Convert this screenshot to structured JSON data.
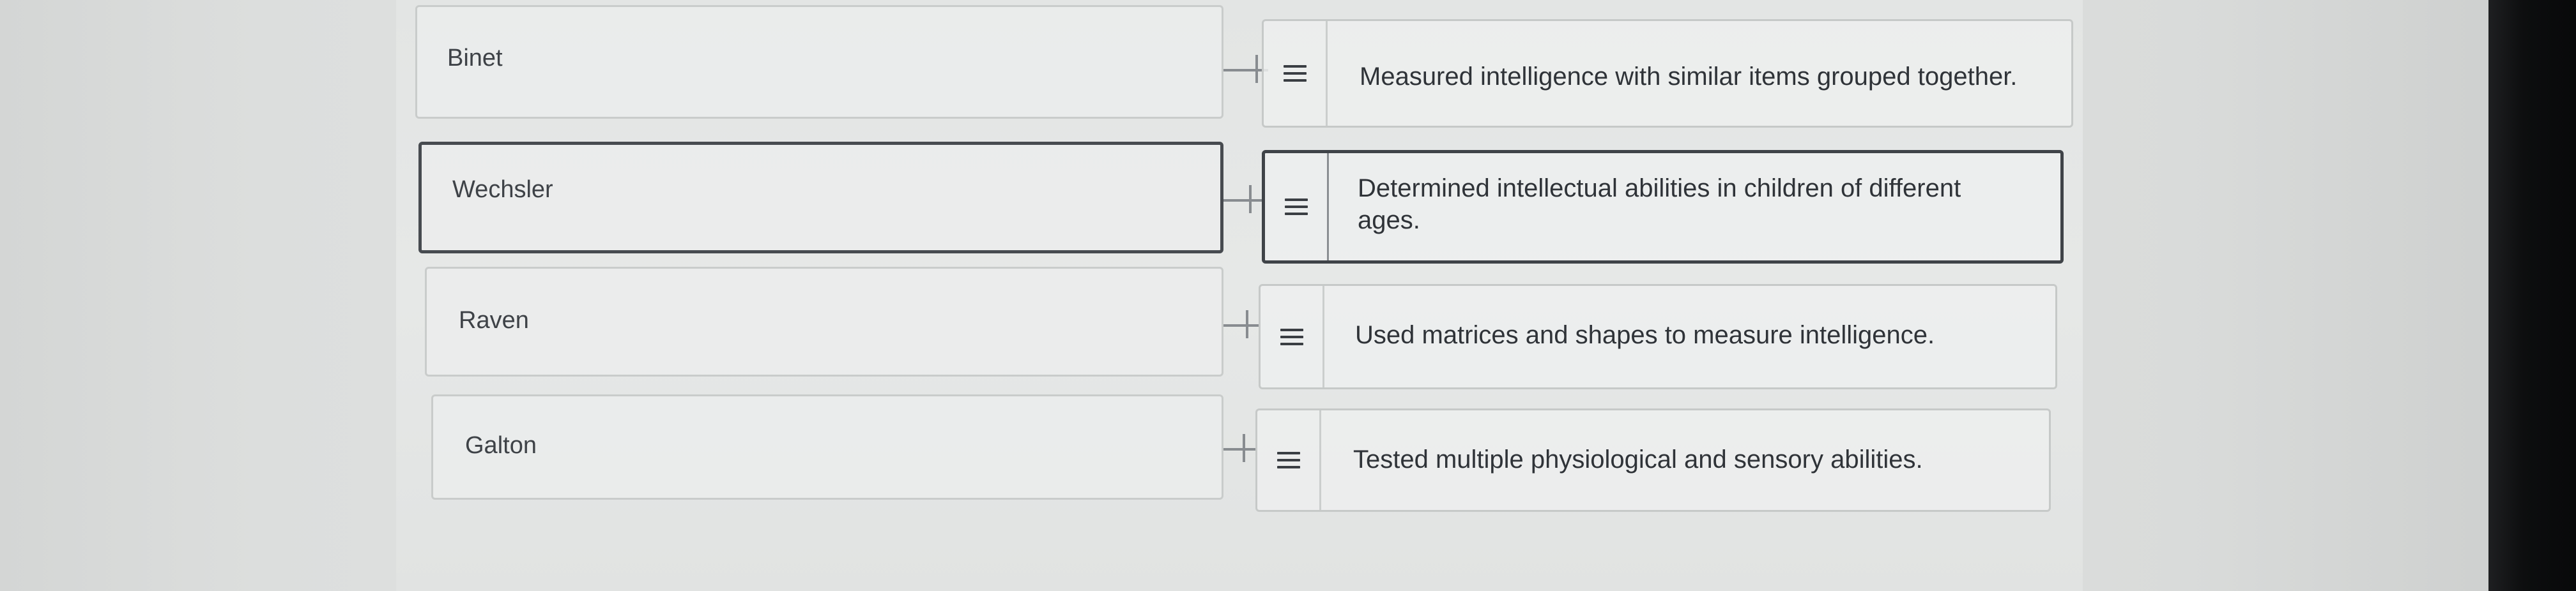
{
  "matching": {
    "rows": [
      {
        "term": "Binet",
        "definition": "Measured intelligence with similar items grouped together."
      },
      {
        "term": "Wechsler",
        "definition": "Determined intellectual abilities in children of different ages."
      },
      {
        "term": "Raven",
        "definition": "Used matrices and shapes to measure intelligence."
      },
      {
        "term": "Galton",
        "definition": "Tested multiple physiological and sensory abilities."
      }
    ],
    "handle_icon": "drag-handle-icon"
  }
}
